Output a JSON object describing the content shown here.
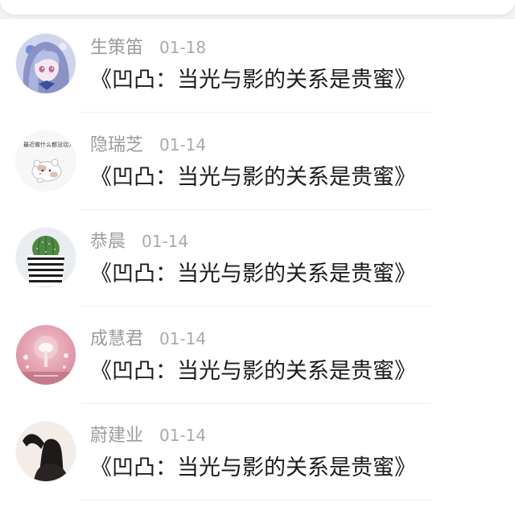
{
  "comments": [
    {
      "user": "生策笛",
      "date": "01-18",
      "title": "《凹凸：当光与影的关系是贵蜜》",
      "avatar": "anime-girl-avatar"
    },
    {
      "user": "隐瑞芝",
      "date": "01-14",
      "title": "《凹凸：当光与影的关系是贵蜜》",
      "avatar": "hamster-sticker-avatar",
      "avatar_caption": "最近做什么都没动力。"
    },
    {
      "user": "恭晨",
      "date": "01-14",
      "title": "《凹凸：当光与影的关系是贵蜜》",
      "avatar": "cactus-pot-avatar"
    },
    {
      "user": "成慧君",
      "date": "01-14",
      "title": "《凹凸：当光与影的关系是贵蜜》",
      "avatar": "pink-lamp-avatar"
    },
    {
      "user": "蔚建业",
      "date": "01-14",
      "title": "《凹凸：当光与影的关系是贵蜜》",
      "avatar": "silhouette-avatar"
    }
  ],
  "colors": {
    "username": "#9b9b9b",
    "date": "#a9a9a9",
    "title": "#1c1c1c",
    "divider": "#eeeeee"
  }
}
